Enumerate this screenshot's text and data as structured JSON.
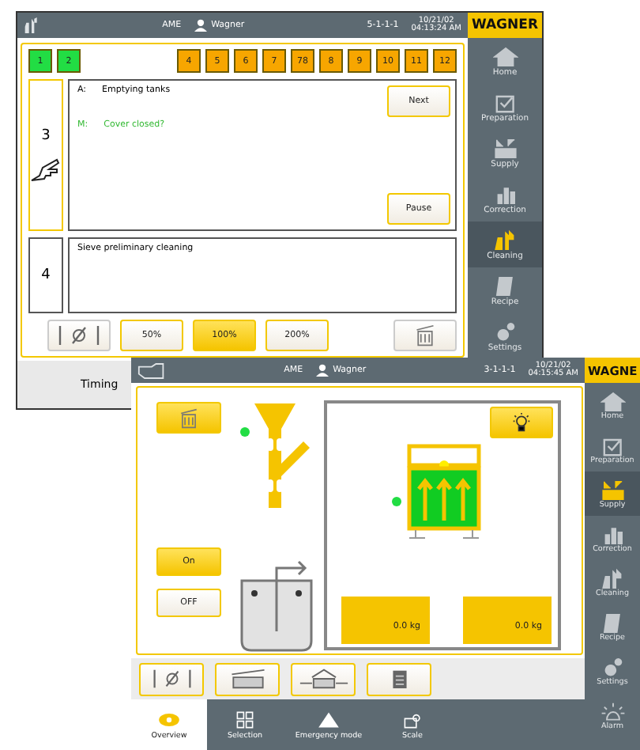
{
  "back_window": {
    "header": {
      "center": "AME",
      "user": "Wagner",
      "code": "5-1-1-1",
      "date": "10/21/02",
      "time": "04:13:24 AM",
      "logo": "WAGNER"
    },
    "step_tiles": [
      {
        "label": "1",
        "color": "#22dd44"
      },
      {
        "label": "2",
        "color": "#22dd44"
      },
      {
        "label": "4",
        "color": "#f7a600"
      },
      {
        "label": "5",
        "color": "#f7a600"
      },
      {
        "label": "6",
        "color": "#f7a600"
      },
      {
        "label": "7",
        "color": "#f7a600"
      },
      {
        "label": "78",
        "color": "#f7a600"
      },
      {
        "label": "8",
        "color": "#f7a600"
      },
      {
        "label": "9",
        "color": "#f7a600"
      },
      {
        "label": "10",
        "color": "#f7a600"
      },
      {
        "label": "11",
        "color": "#f7a600"
      },
      {
        "label": "12",
        "color": "#f7a600"
      }
    ],
    "steps": [
      {
        "number": "3",
        "pointer": true,
        "lines": [
          {
            "kind": "action",
            "prefix": "A:",
            "text": "Emptying tanks"
          },
          {
            "kind": "message",
            "prefix": "M:",
            "text": "Cover closed?"
          }
        ],
        "buttons": [
          "Next",
          "Pause"
        ]
      },
      {
        "number": "4",
        "pointer": false,
        "lines": [
          {
            "kind": "plain",
            "text": "Sieve preliminary cleaning"
          }
        ]
      }
    ],
    "speed_buttons": [
      {
        "label": "50%",
        "selected": false
      },
      {
        "label": "100%",
        "selected": true
      },
      {
        "label": "200%",
        "selected": false
      }
    ],
    "sidebar": [
      {
        "kind": "home",
        "label": "Home",
        "selected": false
      },
      {
        "kind": "preparation",
        "label": "Preparation",
        "selected": false
      },
      {
        "kind": "supply",
        "label": "Supply",
        "selected": false
      },
      {
        "kind": "correction",
        "label": "Correction",
        "selected": false
      },
      {
        "kind": "cleaning",
        "label": "Cleaning",
        "selected": true
      },
      {
        "kind": "recipe",
        "label": "Recipe",
        "selected": false
      },
      {
        "kind": "settings",
        "label": "Settings",
        "selected": false
      }
    ],
    "footer": "Timing"
  },
  "front_window": {
    "header": {
      "center": "AME",
      "user": "Wagner",
      "code": "3-1-1-1",
      "date": "10/21/02",
      "time": "04:15:45 AM",
      "logo": "WAGNE"
    },
    "switch_buttons": [
      {
        "label": "On",
        "selected": true
      },
      {
        "label": "OFF",
        "selected": false
      }
    ],
    "scales": [
      {
        "reading": "0.0 kg"
      },
      {
        "reading": "0.0 kg"
      }
    ],
    "tool_buttons": [
      {
        "kind": "bypass"
      },
      {
        "kind": "tank"
      },
      {
        "kind": "transfer"
      },
      {
        "kind": "document"
      }
    ],
    "bottom_tabs": [
      {
        "kind": "overview",
        "label": "Overview",
        "selected": true
      },
      {
        "kind": "selection",
        "label": "Selection",
        "selected": false
      },
      {
        "kind": "warning",
        "label": "Emergency mode",
        "selected": false
      },
      {
        "kind": "scale",
        "label": "Scale",
        "selected": false
      }
    ],
    "sidebar": [
      {
        "kind": "home",
        "label": "Home",
        "selected": false
      },
      {
        "kind": "preparation",
        "label": "Preparation",
        "selected": false
      },
      {
        "kind": "supply",
        "label": "Supply",
        "selected": true
      },
      {
        "kind": "correction",
        "label": "Correction",
        "selected": false
      },
      {
        "kind": "cleaning",
        "label": "Cleaning",
        "selected": false
      },
      {
        "kind": "recipe",
        "label": "Recipe",
        "selected": false
      },
      {
        "kind": "settings",
        "label": "Settings",
        "selected": false
      },
      {
        "kind": "alarm",
        "label": "Alarm",
        "selected": false
      }
    ]
  }
}
